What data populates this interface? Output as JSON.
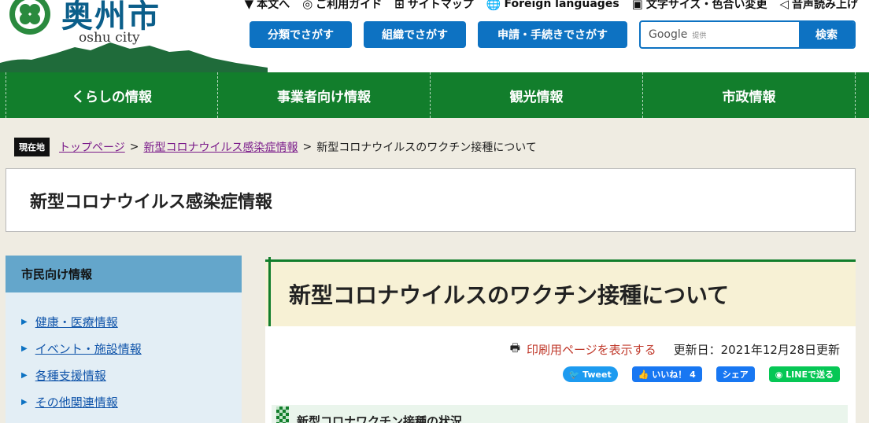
{
  "header": {
    "logo_text": "奥州市",
    "logo_sub": "oshu city",
    "util_links": [
      {
        "icon": "down-arrow-icon",
        "glyph": "▼",
        "label": "本文へ"
      },
      {
        "icon": "guide-icon",
        "glyph": "◎",
        "label": "ご利用ガイド"
      },
      {
        "icon": "sitemap-icon",
        "glyph": "⊞",
        "label": "サイトマップ"
      },
      {
        "icon": "globe-icon",
        "glyph": "🌐",
        "label": "Foreign languages"
      },
      {
        "icon": "text-size-icon",
        "glyph": "▣",
        "label": "文字サイズ・色合い変更"
      },
      {
        "icon": "speaker-icon",
        "glyph": "◁",
        "label": "音声読み上げ"
      }
    ],
    "buttons": {
      "by_category": "分類でさがす",
      "by_organization": "組織でさがす",
      "by_procedure": "申請・手続きでさがす"
    },
    "search": {
      "placeholder": "Google",
      "provided": "提供",
      "button": "検索"
    }
  },
  "nav": [
    "くらしの情報",
    "事業者向け情報",
    "観光情報",
    "市政情報"
  ],
  "breadcrumb": {
    "here": "現在地",
    "items": [
      "トップページ",
      "新型コロナウイルス感染症情報"
    ],
    "current": "新型コロナウイルスのワクチン接種について",
    "sep": ">"
  },
  "category_title": "新型コロナウイルス感染症情報",
  "sidebar": {
    "heading": "市民向け情報",
    "items": [
      "健康・医療情報",
      "イベント・施設情報",
      "各種支援情報",
      "その他関連情報"
    ]
  },
  "main": {
    "title": "新型コロナウイルスのワクチン接種について",
    "print_link": "印刷用ページを表示する",
    "updated": "更新日：2021年12月28日更新",
    "share": {
      "tweet": "Tweet",
      "like": "いいね！ 4",
      "share": "シェア",
      "line": "LINEで送る"
    },
    "sub_heading": "新型コロナワクチン接種の状況"
  },
  "colors": {
    "nav_green": "#127e2c",
    "button_blue": "#0d72c2",
    "sidebar_head": "#64a6cb",
    "title_bg": "#f7f1d5",
    "link_visited": "#7a1a8a"
  }
}
